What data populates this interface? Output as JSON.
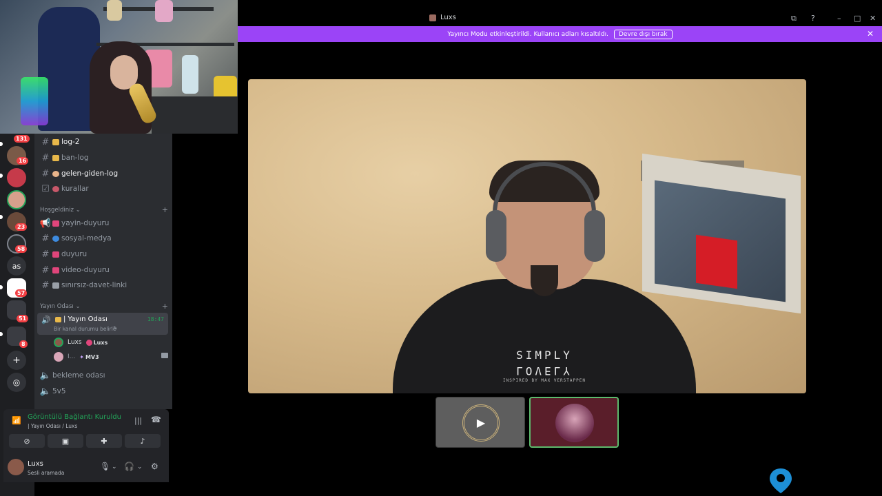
{
  "window": {
    "title": "Luxs"
  },
  "banner": {
    "message": "Yayıncı Modu etkinleştirildi. Kullanıcı adları kısaltıldı.",
    "button_label": "Devre dışı bırak"
  },
  "rail": {
    "badges": [
      "131",
      "16",
      "23",
      "58",
      "57",
      "51",
      "8"
    ],
    "server_text": "as"
  },
  "channels": {
    "log2": "log-2",
    "ban_log": "ban-log",
    "gelen_giden": "gelen-giden-log",
    "kurallar": "kurallar",
    "cat_welcome": "Hoşgeldiniz",
    "yayin_duyuru": "yayin-duyuru",
    "sosyal_medya": "sosyal-medya",
    "duyuru": "duyuru",
    "video_duyuru": "video-duyuru",
    "davet": "sınırsız-davet-linki",
    "cat_stream": "Yayın Odası",
    "active_voice": {
      "name": "| Yayın Odası",
      "time": "18:47",
      "status": "Bir kanal durumu belirle"
    },
    "voice_users": [
      {
        "name": "Luxs",
        "tag": "Luxs"
      },
      {
        "name": "I...",
        "tag": "MV3"
      }
    ],
    "bekleme": "bekleme odası",
    "v5": "5v5"
  },
  "voice_panel": {
    "title": "Görüntülü Bağlantı Kuruldu",
    "subtitle": "| Yayın Odası / Luxs"
  },
  "user_panel": {
    "name": "Luxs",
    "status": "Sesli aramada"
  },
  "video": {
    "shirt_line1": "SIMPLY",
    "shirt_line2": "LOVELY",
    "shirt_small": "INSPIRED BY MAX VERSTAPPEN"
  },
  "colors": {
    "banner": "#9b44f7",
    "connected": "#23a559",
    "badge": "#f23f43",
    "active_border": "#5dbb6d"
  }
}
